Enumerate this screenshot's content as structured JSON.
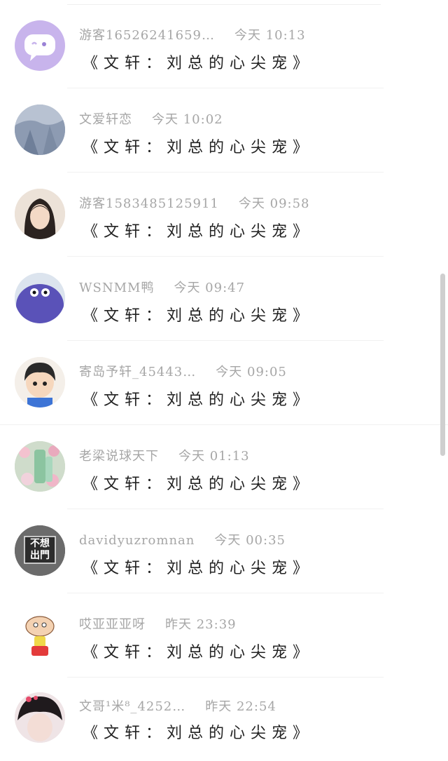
{
  "comments": [
    {
      "user": "游客16526241659…",
      "time": "今天 10:13",
      "text": "《文轩：刘总的心尖宠》",
      "avatar": "chat-bubble-icon"
    },
    {
      "user": "文爱轩恋",
      "time": "今天 10:02",
      "text": "《文轩：刘总的心尖宠》",
      "avatar": "photo"
    },
    {
      "user": "游客1583485125911",
      "time": "今天 09:58",
      "text": "《文轩：刘总的心尖宠》",
      "avatar": "photo"
    },
    {
      "user": "WSNMM鸭",
      "time": "今天 09:47",
      "text": "《文轩：刘总的心尖宠》",
      "avatar": "purple-creature"
    },
    {
      "user": "寄岛予轩_45443…",
      "time": "今天 09:05",
      "text": "《文轩：刘总的心尖宠》",
      "avatar": "cartoon-boy"
    },
    {
      "user": "老梁说球天下",
      "time": "今天 01:13",
      "text": "《文轩：刘总的心尖宠》",
      "avatar": "flowers"
    },
    {
      "user": "davidyuzromnan",
      "time": "今天 00:35",
      "text": "《文轩：刘总的心尖宠》",
      "avatar": "sign",
      "avatar_text": "不想出門"
    },
    {
      "user": "哎亚亚亚呀",
      "time": "昨天 23:39",
      "text": "《文轩：刘总的心尖宠》",
      "avatar": "cartoon-stewie"
    },
    {
      "user": "文哥¹米⁸_4252…",
      "time": "昨天 22:54",
      "text": "《文轩：刘总的心尖宠》",
      "avatar": "photo-face"
    }
  ]
}
